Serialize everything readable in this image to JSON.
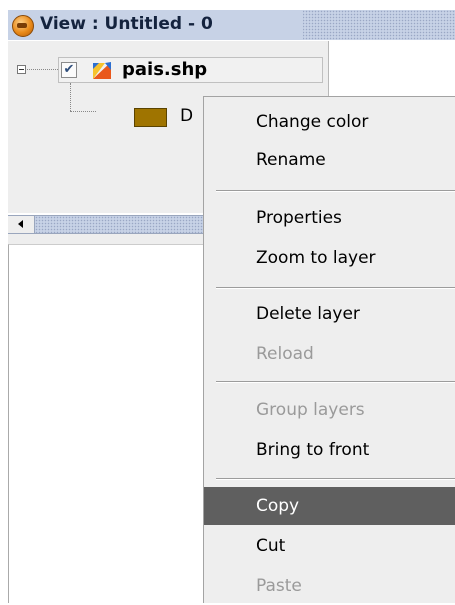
{
  "window": {
    "title": "View : Untitled - 0"
  },
  "toc": {
    "layer": {
      "name": "pais.shp",
      "checked": true,
      "check_glyph": "✔",
      "icon": "layer-shape-icon"
    },
    "legend": {
      "label": "D",
      "swatch_color": "#9f7400"
    }
  },
  "context_menu": {
    "items": [
      {
        "label": "Change color",
        "enabled": true
      },
      {
        "label": "Rename",
        "enabled": true
      },
      {
        "label": "Properties",
        "enabled": true
      },
      {
        "label": "Zoom to layer",
        "enabled": true
      },
      {
        "label": "Delete layer",
        "enabled": true
      },
      {
        "label": "Reload",
        "enabled": false
      },
      {
        "label": "Group layers",
        "enabled": false
      },
      {
        "label": "Bring to front",
        "enabled": true
      },
      {
        "label": "Copy",
        "enabled": true,
        "highlighted": true
      },
      {
        "label": "Cut",
        "enabled": true
      },
      {
        "label": "Paste",
        "enabled": false
      }
    ]
  },
  "colors": {
    "highlight": "#5f5f5f",
    "titlebar": "#c7d2e6",
    "menu_bg": "#eeeeee"
  }
}
